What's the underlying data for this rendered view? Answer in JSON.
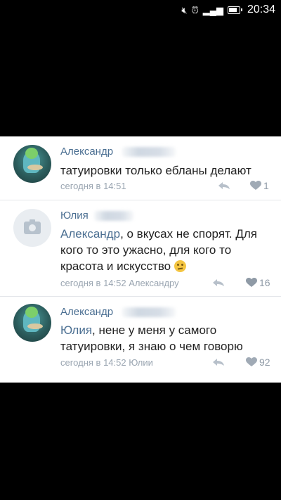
{
  "status_bar": {
    "time": "20:34"
  },
  "comments": [
    {
      "author": "Александр",
      "text": "татуировки только ебланы делают",
      "reply_to": "",
      "time": "сегодня в 14:51",
      "reply_to_label": "",
      "likes": "1"
    },
    {
      "author": "Юлия",
      "reply_to": "Александр",
      "text": ", о вкусах не спорят. Для кого то это ужасно,  для кого то красота и искусство",
      "time": "сегодня в 14:52",
      "reply_to_label": "Александру",
      "likes": "16"
    },
    {
      "author": "Александр",
      "reply_to": "Юлия",
      "text": ", нене у меня у самого татуировки, я знаю о чем говорю",
      "time": "сегодня в 14:52",
      "reply_to_label": "Юлии",
      "likes": "92"
    }
  ],
  "colors": {
    "link": "#4b6f92",
    "meta": "#9aa5b1"
  },
  "icons": [
    "mute-icon",
    "alarm-icon",
    "signal-icon",
    "battery-icon",
    "camera-icon",
    "reply-icon",
    "heart-icon",
    "emoji-confused-icon"
  ]
}
